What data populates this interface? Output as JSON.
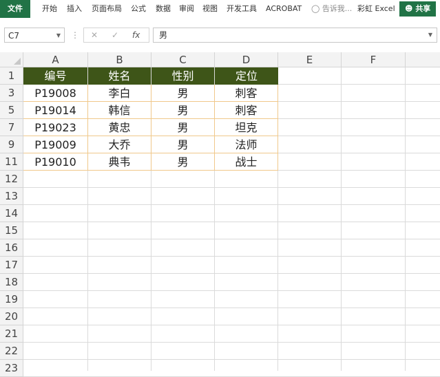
{
  "ribbon": {
    "file": "文件",
    "tabs": [
      "开始",
      "插入",
      "页面布局",
      "公式",
      "数据",
      "审阅",
      "视图",
      "开发工具",
      "ACROBAT"
    ],
    "tell_me": "告诉我...",
    "account": "彩虹 Excel",
    "share": "共享"
  },
  "formula_bar": {
    "name_box": "C7",
    "cancel_icon": "✕",
    "enter_icon": "✓",
    "fx_label": "fx",
    "content": "男"
  },
  "grid": {
    "columns": [
      "A",
      "B",
      "C",
      "D",
      "E",
      "F"
    ],
    "rows": [
      "1",
      "3",
      "5",
      "7",
      "9",
      "11",
      "12",
      "13",
      "14",
      "15",
      "16",
      "17",
      "18",
      "19",
      "20",
      "21",
      "22",
      "23"
    ],
    "header": [
      "编号",
      "姓名",
      "性别",
      "定位"
    ],
    "data": [
      [
        "P19008",
        "李白",
        "男",
        "刺客"
      ],
      [
        "P19014",
        "韩信",
        "男",
        "刺客"
      ],
      [
        "P19023",
        "黄忠",
        "男",
        "坦克"
      ],
      [
        "P19009",
        "大乔",
        "男",
        "法师"
      ],
      [
        "P19010",
        "典韦",
        "男",
        "战士"
      ]
    ]
  },
  "colors": {
    "ribbon_green": "#217346",
    "header_fill": "#3e5518",
    "cell_border": "#f0c88a"
  }
}
